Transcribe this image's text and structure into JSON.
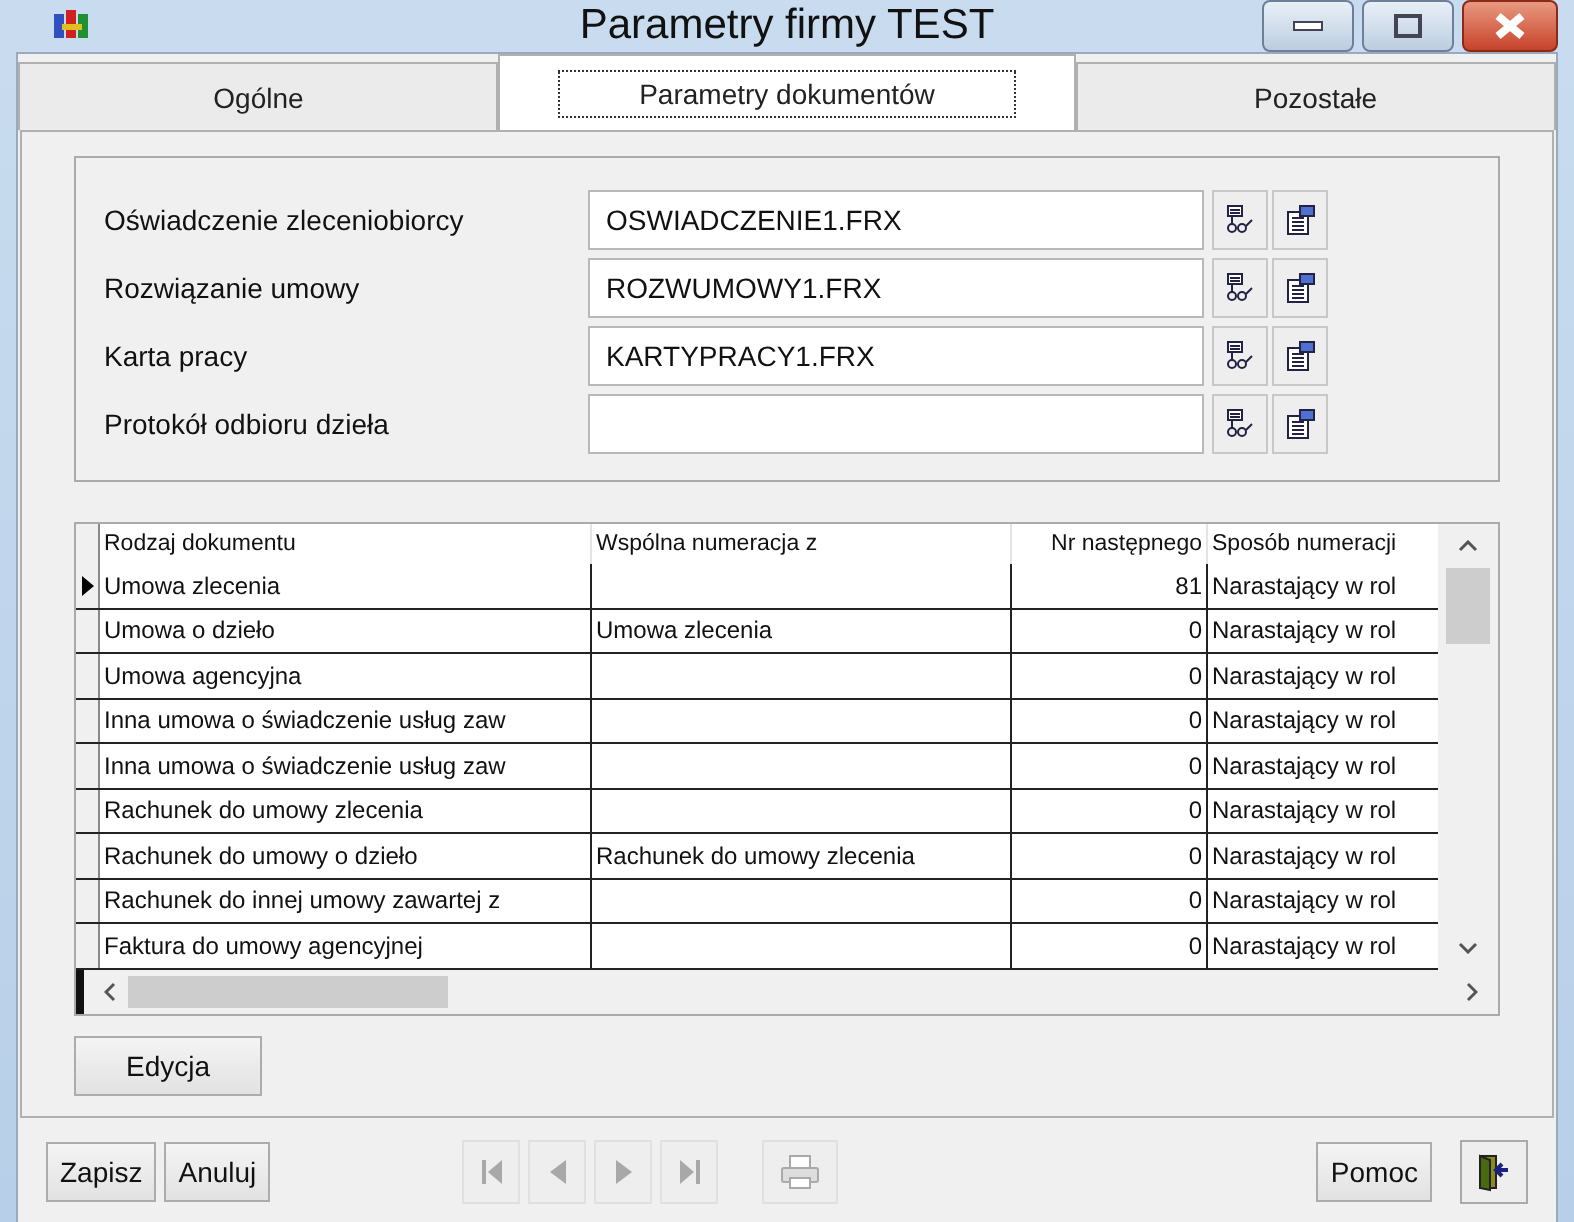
{
  "window": {
    "title": "Parametry firmy TEST"
  },
  "tabs": [
    {
      "label": "Ogólne",
      "selected": false
    },
    {
      "label": "Parametry dokumentów",
      "selected": true
    },
    {
      "label": "Pozostałe",
      "selected": false
    }
  ],
  "templates": [
    {
      "label": "Oświadczenie zleceniobiorcy",
      "value": "OSWIADCZENIE1.FRX"
    },
    {
      "label": "Rozwiązanie umowy",
      "value": "ROZWUMOWY1.FRX"
    },
    {
      "label": "Karta pracy",
      "value": "KARTYPRACY1.FRX"
    },
    {
      "label": "Protokół odbioru dzieła"
    }
  ],
  "table": {
    "columns": [
      "Rodzaj dokumentu",
      "Wspólna numeracja z",
      "Nr następnego",
      "Sposób numeracji"
    ],
    "rows": [
      {
        "cells": [
          "Umowa zlecenia",
          "",
          "81",
          "Narastający w rol"
        ],
        "selected": true
      },
      {
        "cells": [
          "Umowa o dzieło",
          "Umowa zlecenia",
          "0",
          "Narastający w rol"
        ],
        "selected": false
      },
      {
        "cells": [
          "Umowa agencyjna",
          "",
          "0",
          "Narastający w rol"
        ],
        "selected": false
      },
      {
        "cells": [
          "Inna umowa o świadczenie usług zaw",
          "",
          "0",
          "Narastający w rol"
        ],
        "selected": false
      },
      {
        "cells": [
          "Inna umowa o świadczenie usług zaw",
          "",
          "0",
          "Narastający w rol"
        ],
        "selected": false
      },
      {
        "cells": [
          "Rachunek do umowy zlecenia",
          "",
          "0",
          "Narastający w rol"
        ],
        "selected": false
      },
      {
        "cells": [
          "Rachunek do umowy o dzieło",
          "Rachunek do umowy zlecenia",
          "0",
          "Narastający w rol"
        ],
        "selected": false
      },
      {
        "cells": [
          "Rachunek do innej umowy zawartej z",
          "",
          "0",
          "Narastający w rol"
        ],
        "selected": false
      },
      {
        "cells": [
          "Faktura do umowy agencyjnej",
          "",
          "0",
          "Narastający w rol"
        ],
        "selected": false
      }
    ]
  },
  "edit_button": "Edycja",
  "footer": {
    "save": "Zapisz",
    "cancel": "Anuluj",
    "help": "Pomoc",
    "nav": [
      {
        "kind": "first",
        "disabled": true
      },
      {
        "kind": "prev",
        "disabled": true
      },
      {
        "kind": "next",
        "disabled": true
      },
      {
        "kind": "last",
        "disabled": true
      }
    ],
    "print_disabled": true
  }
}
